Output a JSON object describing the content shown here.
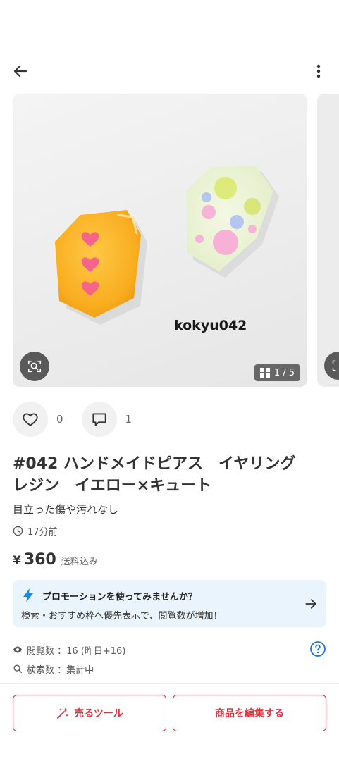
{
  "header": {
    "back_icon": "arrow-left-icon",
    "more_icon": "more-vert-icon"
  },
  "gallery": {
    "watermark": "kokyu042",
    "counter": "1 / 5",
    "counter_icon": "grid-icon",
    "lens_icon": "image-search-icon"
  },
  "actions": {
    "like_icon": "heart-icon",
    "like_count": "0",
    "comment_icon": "comment-icon",
    "comment_count": "1"
  },
  "item": {
    "title": "#042 ハンドメイドピアス　イヤリング　レジン　イエロー×キュート",
    "condition": "目立った傷や汚れなし",
    "time_icon": "clock-icon",
    "posted": "17分前",
    "price_currency": "¥",
    "price": "360",
    "price_note": "送料込み"
  },
  "promo": {
    "icon": "lightning-icon",
    "title": "プロモーションを使ってみませんか？",
    "description": "検索・おすすめ枠へ優先表示で、閲覧数が増加！",
    "arrow_icon": "arrow-right-icon"
  },
  "stats": {
    "views_icon": "eye-icon",
    "views": "閲覧数 ：16 (昨日+16)",
    "search_icon": "search-icon",
    "searches": "検索数 ：集計中",
    "help_icon": "help-icon"
  },
  "buttons": {
    "sell_tool_icon": "sparkle-wand-icon",
    "sell_tool": "売るツール",
    "edit": "商品を編集する"
  },
  "colors": {
    "accent": "#e0313d",
    "promo_bg": "#eaf4fc",
    "promo_icon": "#1e88e5"
  }
}
